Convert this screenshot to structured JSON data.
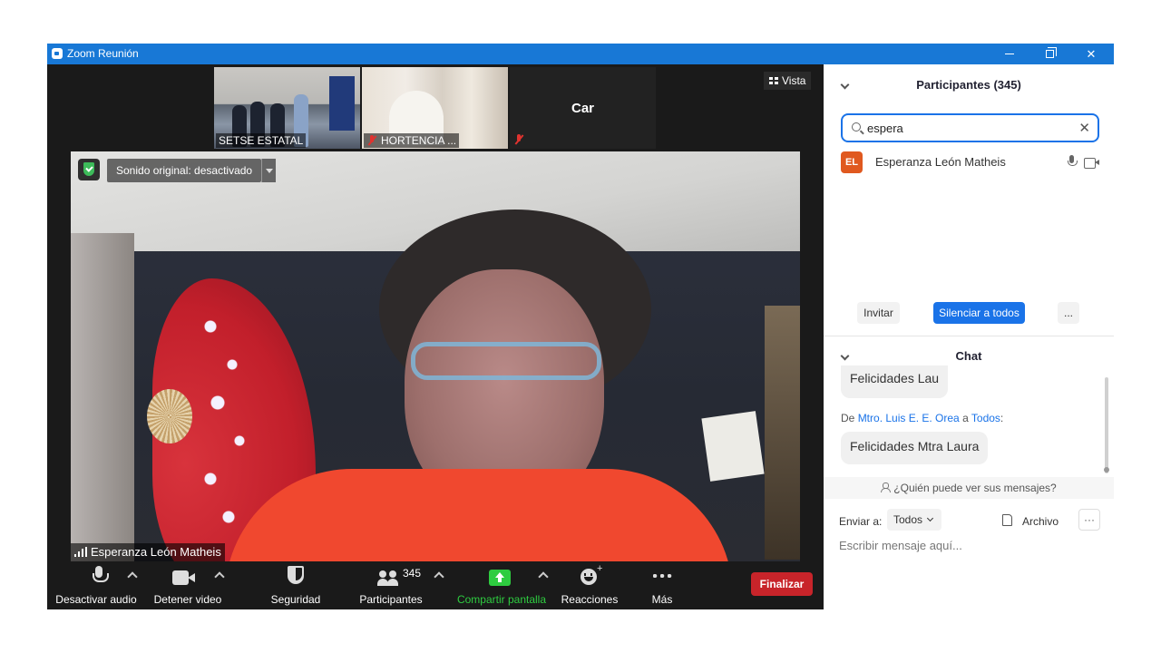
{
  "window": {
    "title": "Zoom Reunión",
    "controls": {
      "minimize": "—",
      "maximize": "▢",
      "close": "✕"
    }
  },
  "meeting": {
    "thumbnails": [
      {
        "name": "SETSE ESTATAL",
        "muted": false
      },
      {
        "name": "HORTENCIA ...",
        "muted": true
      },
      {
        "name": "Car",
        "muted": true
      }
    ],
    "view_label": "Vista",
    "original_sound": "Sonido original: desactivado",
    "speaker_name": "Esperanza León Matheis"
  },
  "toolbar": {
    "audio_label": "Desactivar audio",
    "video_label": "Detener video",
    "security_label": "Seguridad",
    "participants_label": "Participantes",
    "participants_count": "345",
    "share_label": "Compartir pantalla",
    "reactions_label": "Reacciones",
    "more_label": "Más",
    "end_label": "Finalizar"
  },
  "participants_panel": {
    "title": "Participantes (345)",
    "search_value": "espera",
    "items": [
      {
        "initials": "EL",
        "name": "Esperanza León Matheis",
        "avatar_color": "#e0591f"
      }
    ],
    "invite_label": "Invitar",
    "mute_all_label": "Silenciar a todos",
    "more_label": "..."
  },
  "chat_panel": {
    "title": "Chat",
    "messages": [
      {
        "from": "",
        "to": "",
        "text": "Felicidades Lau"
      },
      {
        "from": "Mtro. Luis E. E. Orea",
        "to": "Todos",
        "text": "Felicidades Mtra Laura"
      }
    ],
    "from_prefix": "De",
    "to_word": "a",
    "to_suffix": ":",
    "who_can_see": "¿Quién puede ver sus mensajes?",
    "send_to_label": "Enviar a:",
    "send_to_value": "Todos",
    "file_label": "Archivo",
    "more_label": "···",
    "input_placeholder": "Escribir mensaje aquí..."
  },
  "colors": {
    "titlebar": "#1878d6",
    "accent": "#1a73e8",
    "end_button": "#c8242a",
    "share_green": "#2ecc40"
  }
}
